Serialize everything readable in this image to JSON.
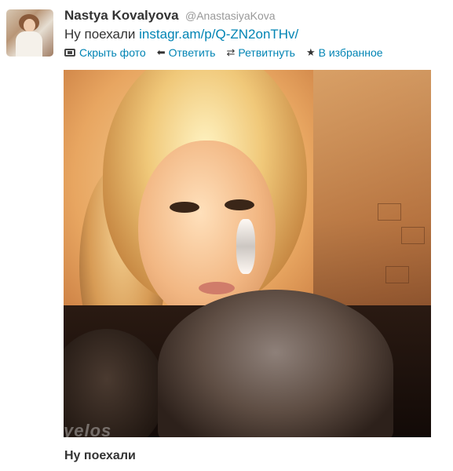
{
  "tweet": {
    "full_name": "Nastya Kovalyova",
    "screen_name": "@AnastasiyaKova",
    "text": "Ну поехали",
    "link": "instagr.am/p/Q-ZN2onTHv/",
    "media_caption": "Ну поехали",
    "watermark": "yelos"
  },
  "actions": {
    "hide_photo": "Скрыть фото",
    "reply": "Ответить",
    "retweet": "Ретвитнуть",
    "favorite": "В избранное"
  },
  "icons": {
    "hide_photo": "photo-icon",
    "reply": "reply-arrow-icon",
    "retweet": "retweet-icon",
    "favorite": "star-icon"
  },
  "colors": {
    "link": "#0084b4",
    "name": "#333333",
    "screen_name": "#999999"
  }
}
